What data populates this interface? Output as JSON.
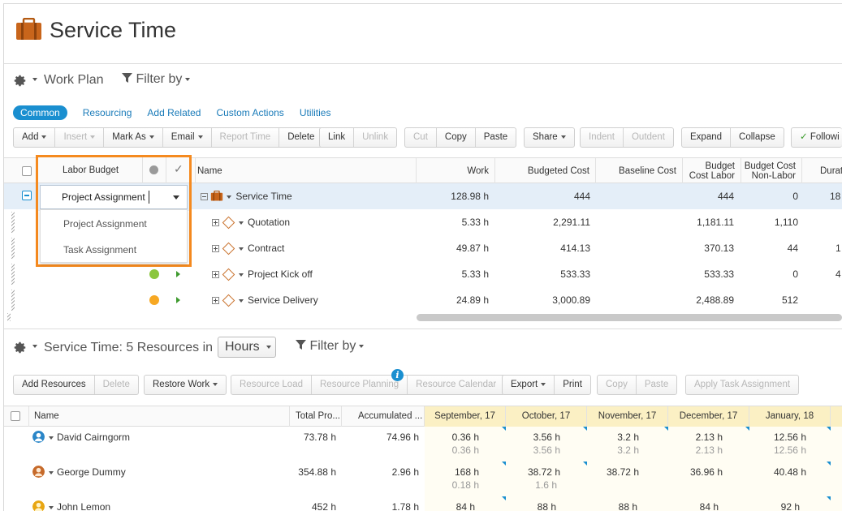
{
  "app": {
    "title": "Service Time",
    "title_icon": "briefcase-icon"
  },
  "workplan": {
    "section_title": "Work Plan",
    "filter_label": "Filter by",
    "tabs": [
      {
        "label": "Common",
        "active": true
      },
      {
        "label": "Resourcing"
      },
      {
        "label": "Add Related"
      },
      {
        "label": "Custom Actions"
      },
      {
        "label": "Utilities"
      }
    ],
    "toolbar": {
      "add": "Add",
      "insert": "Insert",
      "mark_as": "Mark As",
      "email": "Email",
      "report_time": "Report Time",
      "delete": "Delete",
      "link": "Link",
      "unlink": "Unlink",
      "cut": "Cut",
      "copy": "Copy",
      "paste": "Paste",
      "share": "Share",
      "indent": "Indent",
      "outdent": "Outdent",
      "expand": "Expand",
      "collapse": "Collapse",
      "following": "Followi"
    },
    "columns": {
      "labor_budget": "Labor Budget",
      "name": "Name",
      "work": "Work",
      "budgeted_cost": "Budgeted Cost",
      "baseline_cost": "Baseline Cost",
      "budget_cost_labor_1": "Budget",
      "budget_cost_labor_2": "Cost Labor",
      "budget_cost_nonlabor_1": "Budget Cost",
      "budget_cost_nonlabor_2": "Non-Labor",
      "duration": "Durat"
    },
    "dropdown": {
      "selected": "Project Assignment",
      "options": [
        "Project Assignment",
        "Task Assignment"
      ]
    },
    "rows": [
      {
        "name": "Service Time",
        "work": "128.98 h",
        "budgeted_cost": "444",
        "budget_cost_labor": "444",
        "budget_cost_nonlabor": "0",
        "duration": "18"
      },
      {
        "name": "Quotation",
        "work": "5.33 h",
        "budgeted_cost": "2,291.11",
        "budget_cost_labor": "1,181.11",
        "budget_cost_nonlabor": "1,110",
        "duration": ""
      },
      {
        "name": "Contract",
        "work": "49.87 h",
        "budgeted_cost": "414.13",
        "budget_cost_labor": "370.13",
        "budget_cost_nonlabor": "44",
        "duration": "1"
      },
      {
        "name": "Project Kick off",
        "work": "5.33 h",
        "budgeted_cost": "533.33",
        "budget_cost_labor": "533.33",
        "budget_cost_nonlabor": "0",
        "duration": "4"
      },
      {
        "name": "Service Delivery",
        "work": "24.89 h",
        "budgeted_cost": "3,000.89",
        "budget_cost_labor": "2,488.89",
        "budget_cost_nonlabor": "512",
        "duration": ""
      }
    ],
    "status_colors": {
      "green": "#8bc63e",
      "orange": "#f7a823"
    }
  },
  "resources": {
    "section_title": "Service Time: 5 Resources in",
    "unit": "Hours",
    "filter_label": "Filter by",
    "toolbar": {
      "add_resources": "Add Resources",
      "delete": "Delete",
      "restore_work": "Restore Work",
      "resource_load": "Resource Load",
      "resource_planning": "Resource Planning",
      "resource_calendar": "Resource Calendar",
      "export": "Export",
      "print": "Print",
      "copy": "Copy",
      "paste": "Paste",
      "apply_task_assignment": "Apply Task Assignment",
      "info": "i"
    },
    "columns": {
      "name": "Name",
      "total": "Total Pro...",
      "accumulated": "Accumulated ...",
      "months": [
        "September, 17",
        "October, 17",
        "November, 17",
        "December, 17",
        "January, 18"
      ]
    },
    "rows": [
      {
        "name": "David Cairngorm",
        "total": "73.78 h",
        "accumulated": "74.96 h",
        "months": [
          "0.36 h",
          "3.56 h",
          "3.2 h",
          "2.13 h",
          "12.56 h"
        ],
        "subs": [
          "0.36 h",
          "3.56 h",
          "3.2 h",
          "2.13 h",
          "12.56 h"
        ]
      },
      {
        "name": "George Dummy",
        "total": "354.88 h",
        "accumulated": "2.96 h",
        "months": [
          "168 h",
          "38.72 h",
          "38.72 h",
          "36.96 h",
          "40.48 h"
        ],
        "subs": [
          "0.18 h",
          "1.6 h",
          "",
          "",
          ""
        ]
      },
      {
        "name": "John Lemon",
        "total": "452 h",
        "accumulated": "1.78 h",
        "months": [
          "84 h",
          "88 h",
          "88 h",
          "84 h",
          "92 h"
        ],
        "subs": [
          "",
          "",
          "",
          "",
          ""
        ]
      }
    ]
  }
}
